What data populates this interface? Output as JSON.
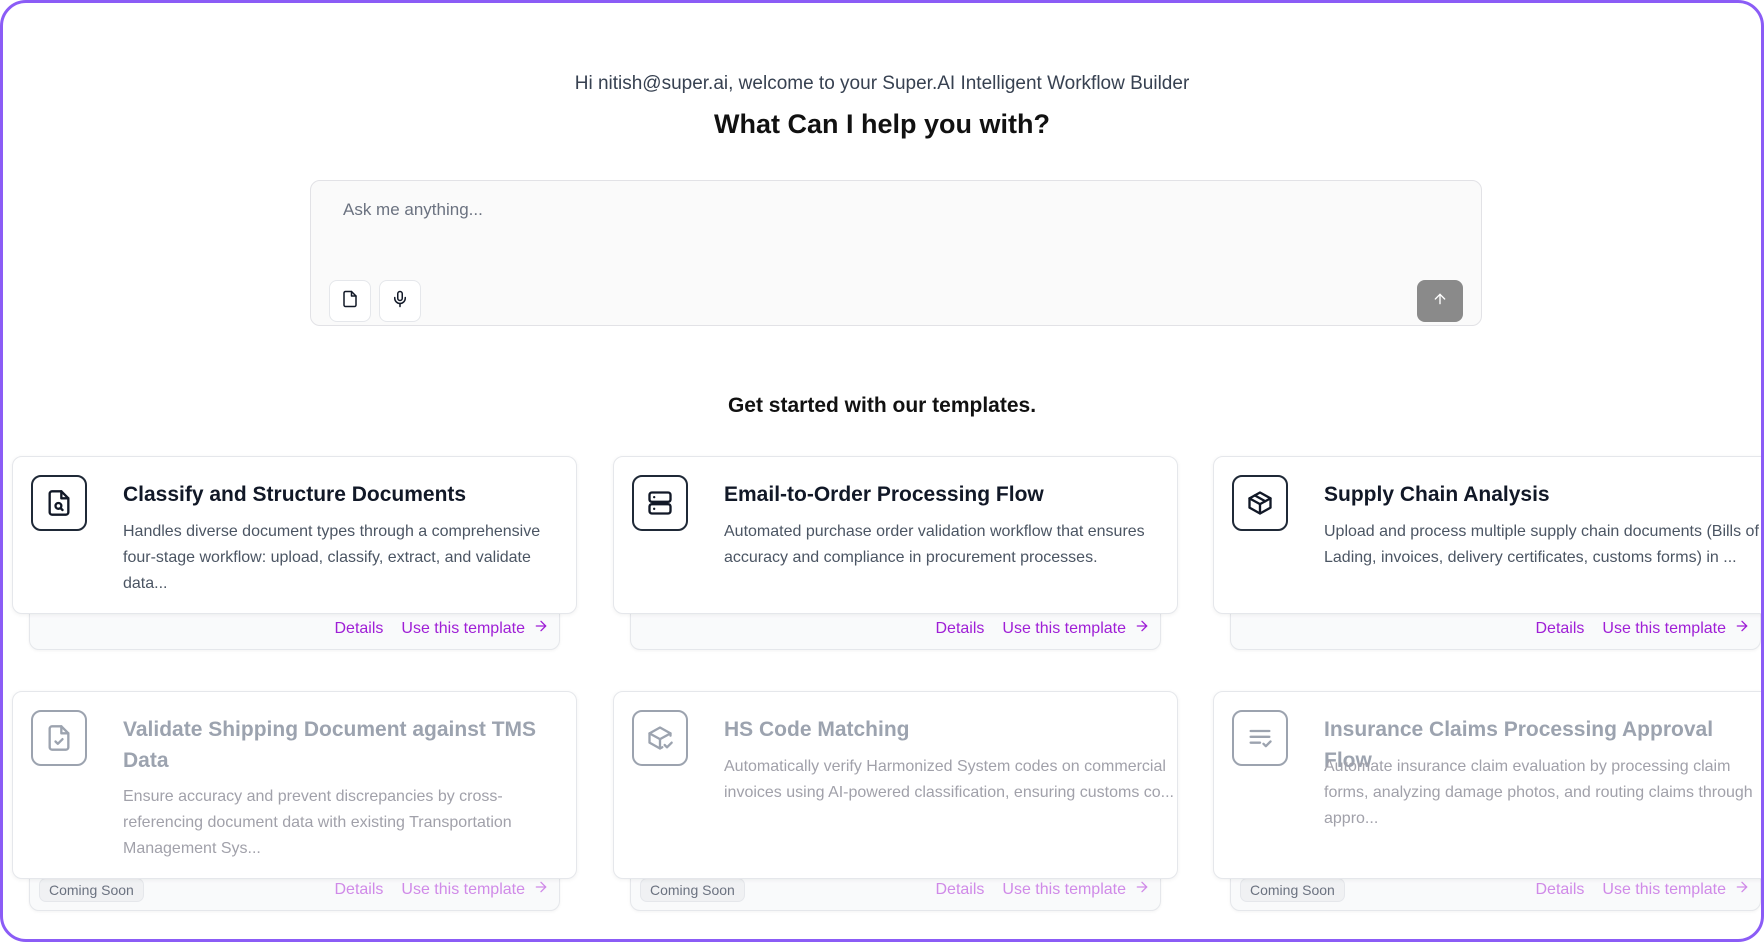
{
  "header": {
    "greeting": "Hi nitish@super.ai, welcome to your Super.AI Intelligent Workflow Builder",
    "headline": "What Can I help you with?"
  },
  "ask": {
    "placeholder": "Ask me anything...",
    "attach_icon": "file-icon",
    "mic_icon": "microphone-icon",
    "send_icon": "arrow-up-icon"
  },
  "templates": {
    "section_title": "Get started with our templates.",
    "details_label": "Details",
    "use_label": "Use this template",
    "coming_soon_label": "Coming Soon",
    "items": [
      {
        "title": "Classify and Structure Documents",
        "description": "Handles diverse document types through a comprehensive four-stage workflow: upload, classify, extract, and validate data...",
        "icon": "document-search-icon"
      },
      {
        "title": "Email-to-Order Processing Flow",
        "description": "Automated purchase order validation workflow that ensures accuracy and compliance in procurement processes.",
        "icon": "server-icon"
      },
      {
        "title": "Supply Chain Analysis",
        "description": "Upload and process multiple supply chain documents (Bills of Lading, invoices, delivery certificates, customs forms) in ...",
        "icon": "package-icon"
      },
      {
        "title": "Validate Shipping Document against TMS Data",
        "description": "Ensure accuracy and prevent discrepancies by cross-referencing document data with existing Transportation Management Sys...",
        "icon": "file-check-icon"
      },
      {
        "title": "HS Code Matching",
        "description": "Automatically verify Harmonized System codes on commercial invoices using AI-powered classification, ensuring customs co...",
        "icon": "package-check-icon"
      },
      {
        "title": "Insurance Claims Processing Approval Flow",
        "description": "Automate insurance claim evaluation by processing claim forms, analyzing damage photos, and routing claims through appro...",
        "icon": "list-check-icon"
      }
    ]
  },
  "colors": {
    "frame_border": "#8b5cf6",
    "accent": "#9f1fd6",
    "accent_disabled": "#d08ae8",
    "send_button": "#8a8a8a"
  }
}
